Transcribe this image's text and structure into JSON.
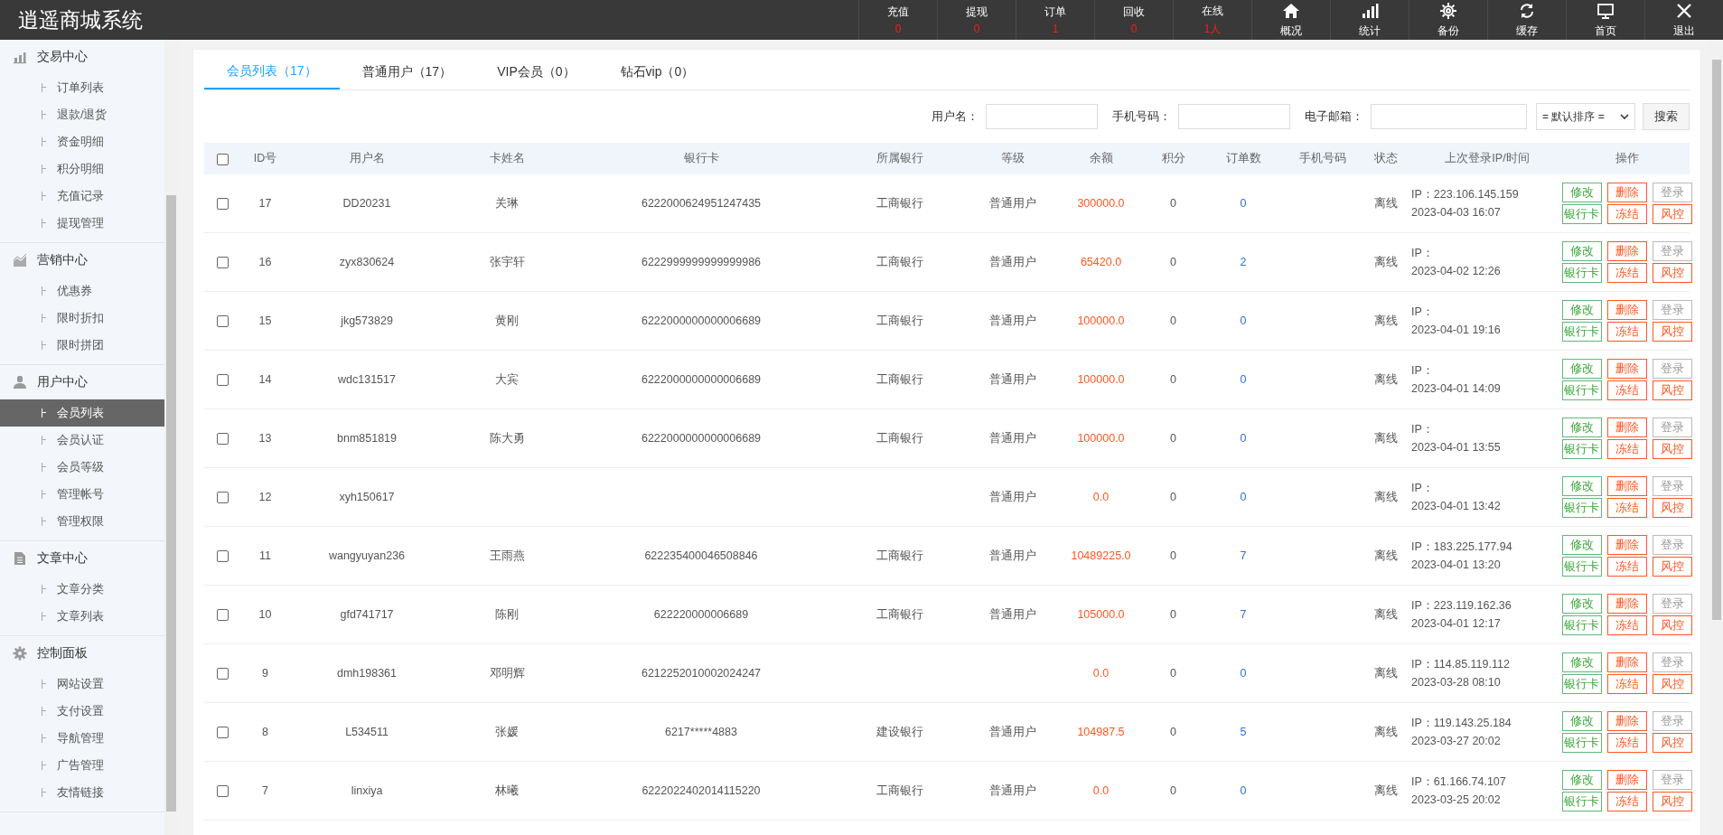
{
  "header": {
    "title": "逍遥商城系统",
    "stats": [
      {
        "label": "充值",
        "value": "0"
      },
      {
        "label": "提现",
        "value": "0"
      },
      {
        "label": "订单",
        "value": "1"
      },
      {
        "label": "回收",
        "value": "0"
      },
      {
        "label": "在线",
        "value": "1人"
      }
    ],
    "actions": [
      {
        "label": "概况",
        "kind": "home"
      },
      {
        "label": "统计",
        "kind": "stats"
      },
      {
        "label": "备份",
        "kind": "backup"
      },
      {
        "label": "缓存",
        "kind": "cache"
      },
      {
        "label": "首页",
        "kind": "monitor"
      },
      {
        "label": "退出",
        "kind": "exit"
      }
    ]
  },
  "sidebar": {
    "groups": [
      {
        "title": "交易中心",
        "kind": "bars",
        "items": [
          {
            "label": "订单列表",
            "selected": false
          },
          {
            "label": "退款/退货",
            "selected": false
          },
          {
            "label": "资金明细",
            "selected": false
          },
          {
            "label": "积分明细",
            "selected": false
          },
          {
            "label": "充值记录",
            "selected": false
          },
          {
            "label": "提现管理",
            "selected": false
          }
        ]
      },
      {
        "title": "营销中心",
        "kind": "area",
        "items": [
          {
            "label": "优惠券",
            "selected": false
          },
          {
            "label": "限时折扣",
            "selected": false
          },
          {
            "label": "限时拼团",
            "selected": false
          }
        ]
      },
      {
        "title": "用户中心",
        "kind": "user",
        "items": [
          {
            "label": "会员列表",
            "selected": true
          },
          {
            "label": "会员认证",
            "selected": false
          },
          {
            "label": "会员等级",
            "selected": false
          },
          {
            "label": "管理帐号",
            "selected": false
          },
          {
            "label": "管理权限",
            "selected": false
          }
        ]
      },
      {
        "title": "文章中心",
        "kind": "doc",
        "items": [
          {
            "label": "文章分类",
            "selected": false
          },
          {
            "label": "文章列表",
            "selected": false
          }
        ]
      },
      {
        "title": "控制面板",
        "kind": "gear",
        "items": [
          {
            "label": "网站设置",
            "selected": false
          },
          {
            "label": "支付设置",
            "selected": false
          },
          {
            "label": "导航管理",
            "selected": false
          },
          {
            "label": "广告管理",
            "selected": false
          },
          {
            "label": "友情链接",
            "selected": false
          }
        ]
      }
    ]
  },
  "tabs": [
    {
      "label": "会员列表（17）",
      "selected": true
    },
    {
      "label": "普通用户（17）",
      "selected": false
    },
    {
      "label": "VIP会员（0）",
      "selected": false
    },
    {
      "label": "钻石vip（0）",
      "selected": false
    }
  ],
  "filters": {
    "fields": [
      {
        "label": "用户名："
      },
      {
        "label": "手机号码："
      },
      {
        "label": "电子邮箱："
      }
    ],
    "sort": {
      "value": "= 默认排序 ="
    },
    "search_button": "搜索"
  },
  "table": {
    "all_checked": false,
    "columns": [
      "ID号",
      "用户名",
      "卡姓名",
      "银行卡",
      "所属银行",
      "等级",
      "余额",
      "积分",
      "订单数",
      "手机号码",
      "状态",
      "上次登录IP/时间",
      "操作"
    ],
    "rows": [
      {
        "checked": false,
        "id": "17",
        "username": "DD20231",
        "card_name": "关琳",
        "bank_card": "6222000624951247435",
        "bank": "工商银行",
        "level": "普通用户",
        "balance": "300000.0",
        "points": "0",
        "orders": "0",
        "status": "离线",
        "ip": "IP：223.106.145.159",
        "login_time": "2023-04-03 16:07",
        "actions": [
          {
            "label": "修改",
            "kind": "ok"
          },
          {
            "label": "删除",
            "kind": "warn"
          },
          {
            "label": "登录",
            "kind": "muted"
          },
          {
            "label": "银行卡",
            "kind": "ok"
          },
          {
            "label": "冻结",
            "kind": "warn"
          },
          {
            "label": "风控",
            "kind": "warn"
          }
        ]
      },
      {
        "checked": false,
        "id": "16",
        "username": "zyx830624",
        "card_name": "张宇轩",
        "bank_card": "6222999999999999986",
        "bank": "工商银行",
        "level": "普通用户",
        "balance": "65420.0",
        "points": "0",
        "orders": "2",
        "status": "离线",
        "ip": "IP：",
        "login_time": "2023-04-02 12:26",
        "actions": [
          {
            "label": "修改",
            "kind": "ok"
          },
          {
            "label": "删除",
            "kind": "warn"
          },
          {
            "label": "登录",
            "kind": "muted"
          },
          {
            "label": "银行卡",
            "kind": "ok"
          },
          {
            "label": "冻结",
            "kind": "warn"
          },
          {
            "label": "风控",
            "kind": "warn"
          }
        ]
      },
      {
        "checked": false,
        "id": "15",
        "username": "jkg573829",
        "card_name": "黄刚",
        "bank_card": "6222000000000006689",
        "bank": "工商银行",
        "level": "普通用户",
        "balance": "100000.0",
        "points": "0",
        "orders": "0",
        "status": "离线",
        "ip": "IP：",
        "login_time": "2023-04-01 19:16",
        "actions": [
          {
            "label": "修改",
            "kind": "ok"
          },
          {
            "label": "删除",
            "kind": "warn"
          },
          {
            "label": "登录",
            "kind": "muted"
          },
          {
            "label": "银行卡",
            "kind": "ok"
          },
          {
            "label": "冻结",
            "kind": "warn"
          },
          {
            "label": "风控",
            "kind": "warn"
          }
        ]
      },
      {
        "checked": false,
        "id": "14",
        "username": "wdc131517",
        "card_name": "大宾",
        "bank_card": "6222000000000006689",
        "bank": "工商银行",
        "level": "普通用户",
        "balance": "100000.0",
        "points": "0",
        "orders": "0",
        "status": "离线",
        "ip": "IP：",
        "login_time": "2023-04-01 14:09",
        "actions": [
          {
            "label": "修改",
            "kind": "ok"
          },
          {
            "label": "删除",
            "kind": "warn"
          },
          {
            "label": "登录",
            "kind": "muted"
          },
          {
            "label": "银行卡",
            "kind": "ok"
          },
          {
            "label": "冻结",
            "kind": "warn"
          },
          {
            "label": "风控",
            "kind": "warn"
          }
        ]
      },
      {
        "checked": false,
        "id": "13",
        "username": "bnm851819",
        "card_name": "陈大勇",
        "bank_card": "6222000000000006689",
        "bank": "工商银行",
        "level": "普通用户",
        "balance": "100000.0",
        "points": "0",
        "orders": "0",
        "status": "离线",
        "ip": "IP：",
        "login_time": "2023-04-01 13:55",
        "actions": [
          {
            "label": "修改",
            "kind": "ok"
          },
          {
            "label": "删除",
            "kind": "warn"
          },
          {
            "label": "登录",
            "kind": "muted"
          },
          {
            "label": "银行卡",
            "kind": "ok"
          },
          {
            "label": "冻结",
            "kind": "warn"
          },
          {
            "label": "风控",
            "kind": "warn"
          }
        ]
      },
      {
        "checked": false,
        "id": "12",
        "username": "xyh150617",
        "level": "普通用户",
        "balance": "0.0",
        "points": "0",
        "orders": "0",
        "status": "离线",
        "ip": "IP：",
        "login_time": "2023-04-01 13:42",
        "actions": [
          {
            "label": "修改",
            "kind": "ok"
          },
          {
            "label": "删除",
            "kind": "warn"
          },
          {
            "label": "登录",
            "kind": "muted"
          },
          {
            "label": "银行卡",
            "kind": "ok"
          },
          {
            "label": "冻结",
            "kind": "warn"
          },
          {
            "label": "风控",
            "kind": "warn"
          }
        ]
      },
      {
        "checked": false,
        "id": "11",
        "username": "wangyuyan236",
        "card_name": "王雨燕",
        "bank_card": "622235400046508846",
        "bank": "工商银行",
        "level": "普通用户",
        "balance": "10489225.0",
        "points": "0",
        "orders": "7",
        "status": "离线",
        "ip": "IP：183.225.177.94",
        "login_time": "2023-04-01 13:20",
        "actions": [
          {
            "label": "修改",
            "kind": "ok"
          },
          {
            "label": "删除",
            "kind": "warn"
          },
          {
            "label": "登录",
            "kind": "muted"
          },
          {
            "label": "银行卡",
            "kind": "ok"
          },
          {
            "label": "冻结",
            "kind": "warn"
          },
          {
            "label": "风控",
            "kind": "warn"
          }
        ]
      },
      {
        "checked": false,
        "id": "10",
        "username": "gfd741717",
        "card_name": "陈刚",
        "bank_card": "622220000006689",
        "bank": "工商银行",
        "level": "普通用户",
        "balance": "105000.0",
        "points": "0",
        "orders": "7",
        "status": "离线",
        "ip": "IP：223.119.162.36",
        "login_time": "2023-04-01 12:17",
        "actions": [
          {
            "label": "修改",
            "kind": "ok"
          },
          {
            "label": "删除",
            "kind": "warn"
          },
          {
            "label": "登录",
            "kind": "muted"
          },
          {
            "label": "银行卡",
            "kind": "ok"
          },
          {
            "label": "冻结",
            "kind": "warn"
          },
          {
            "label": "风控",
            "kind": "warn"
          }
        ]
      },
      {
        "checked": false,
        "id": "9",
        "username": "dmh198361",
        "card_name": "邓明辉",
        "bank_card": "6212252010002024247",
        "balance": "0.0",
        "points": "0",
        "orders": "0",
        "status": "离线",
        "ip": "IP：114.85.119.112",
        "login_time": "2023-03-28 08:10",
        "actions": [
          {
            "label": "修改",
            "kind": "ok"
          },
          {
            "label": "删除",
            "kind": "warn"
          },
          {
            "label": "登录",
            "kind": "muted"
          },
          {
            "label": "银行卡",
            "kind": "ok"
          },
          {
            "label": "冻结",
            "kind": "warn"
          },
          {
            "label": "风控",
            "kind": "warn"
          }
        ]
      },
      {
        "checked": false,
        "id": "8",
        "username": "L534511",
        "card_name": "张媛",
        "bank_card": "6217*****4883",
        "bank": "建设银行",
        "level": "普通用户",
        "balance": "104987.5",
        "points": "0",
        "orders": "5",
        "status": "离线",
        "ip": "IP：119.143.25.184",
        "login_time": "2023-03-27 20:02",
        "actions": [
          {
            "label": "修改",
            "kind": "ok"
          },
          {
            "label": "删除",
            "kind": "warn"
          },
          {
            "label": "登录",
            "kind": "muted"
          },
          {
            "label": "银行卡",
            "kind": "ok"
          },
          {
            "label": "冻结",
            "kind": "warn"
          },
          {
            "label": "风控",
            "kind": "warn"
          }
        ]
      },
      {
        "checked": false,
        "id": "7",
        "username": "linxiya",
        "card_name": "林曦",
        "bank_card": "6222022402014115220",
        "bank": "工商银行",
        "level": "普通用户",
        "balance": "0.0",
        "points": "0",
        "orders": "0",
        "status": "离线",
        "ip": "IP：61.166.74.107",
        "login_time": "2023-03-25 20:02",
        "actions": [
          {
            "label": "修改",
            "kind": "ok"
          },
          {
            "label": "删除",
            "kind": "warn"
          },
          {
            "label": "登录",
            "kind": "muted"
          },
          {
            "label": "银行卡",
            "kind": "ok"
          },
          {
            "label": "冻结",
            "kind": "warn"
          },
          {
            "label": "风控",
            "kind": "warn"
          }
        ]
      }
    ]
  }
}
